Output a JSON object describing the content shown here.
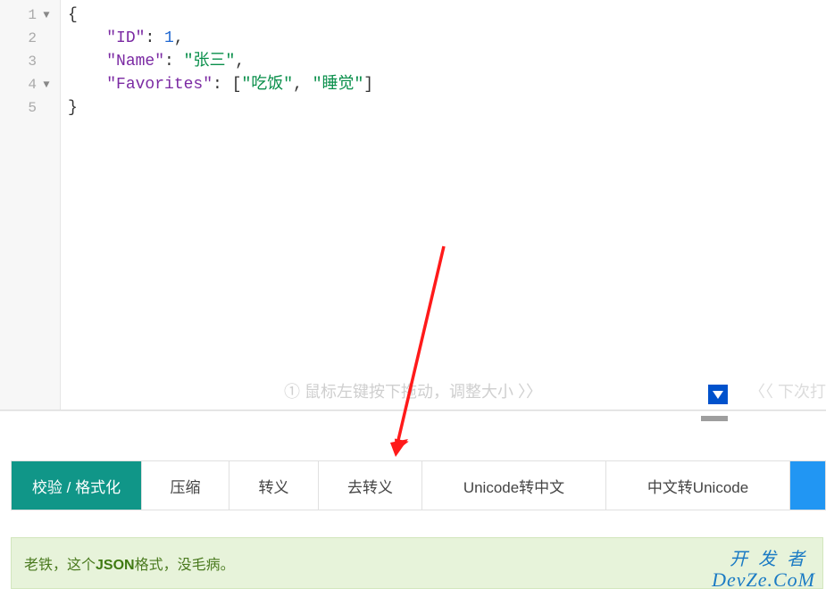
{
  "editor": {
    "lines": [
      {
        "num": "1",
        "fold": "▼"
      },
      {
        "num": "2",
        "fold": ""
      },
      {
        "num": "3",
        "fold": ""
      },
      {
        "num": "4",
        "fold": "▼"
      },
      {
        "num": "5",
        "fold": ""
      }
    ],
    "code": {
      "l1_open": "{",
      "l2_key": "\"ID\"",
      "l2_colon": ": ",
      "l2_val": "1",
      "l2_comma": ",",
      "l3_key": "\"Name\"",
      "l3_colon": ": ",
      "l3_val": "\"张三\"",
      "l3_comma": ",",
      "l4_key": "\"Favorites\"",
      "l4_colon": ": ",
      "l4_open": "[",
      "l4_v1": "\"吃饭\"",
      "l4_sep": ", ",
      "l4_v2": "\"睡觉\"",
      "l4_close": "]",
      "l5_close": "}"
    },
    "hint_circled": "①",
    "hint_text": " 鼠标左键按下拖动，调整大小 〉〉",
    "next_text": "〈〈 下次打"
  },
  "toolbar": {
    "validate": "校验 / 格式化",
    "compress": "压缩",
    "escape": "转义",
    "unescape": "去转义",
    "u2cn": "Unicode转中文",
    "cn2u": "中文转Unicode",
    "tail": ""
  },
  "status": {
    "prefix": "老铁，这个",
    "bold": "JSON",
    "mid": "格式，没毛病。"
  },
  "watermark": {
    "row1": "开发者",
    "row2": "DevZe.CoM"
  }
}
